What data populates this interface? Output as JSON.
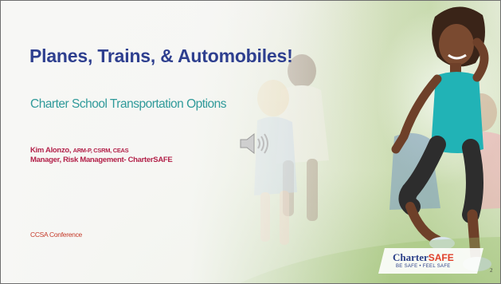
{
  "slide": {
    "title": "Planes, Trains, & Automobiles!",
    "subtitle": "Charter School Transportation Options",
    "presenter": {
      "name": "Kim Alonzo, ",
      "credentials": "ARM-P, CSRM, CEAS",
      "role": "Manager, Risk Management- CharterSAFE"
    },
    "conference": "CCSA Conference",
    "logo": {
      "brand_main": "Charter",
      "brand_accent": "SAFE",
      "tagline": "BE SAFE • FEEL SAFE"
    },
    "slide_number": "2"
  },
  "audio_icon": "speaker-volume-icon",
  "colors": {
    "title": "#2e3f8f",
    "subtitle": "#2f9a9a",
    "presenter": "#b3224a",
    "conference": "#c53a2a",
    "logo_blue": "#2b3f88",
    "logo_orange": "#e0402a"
  }
}
